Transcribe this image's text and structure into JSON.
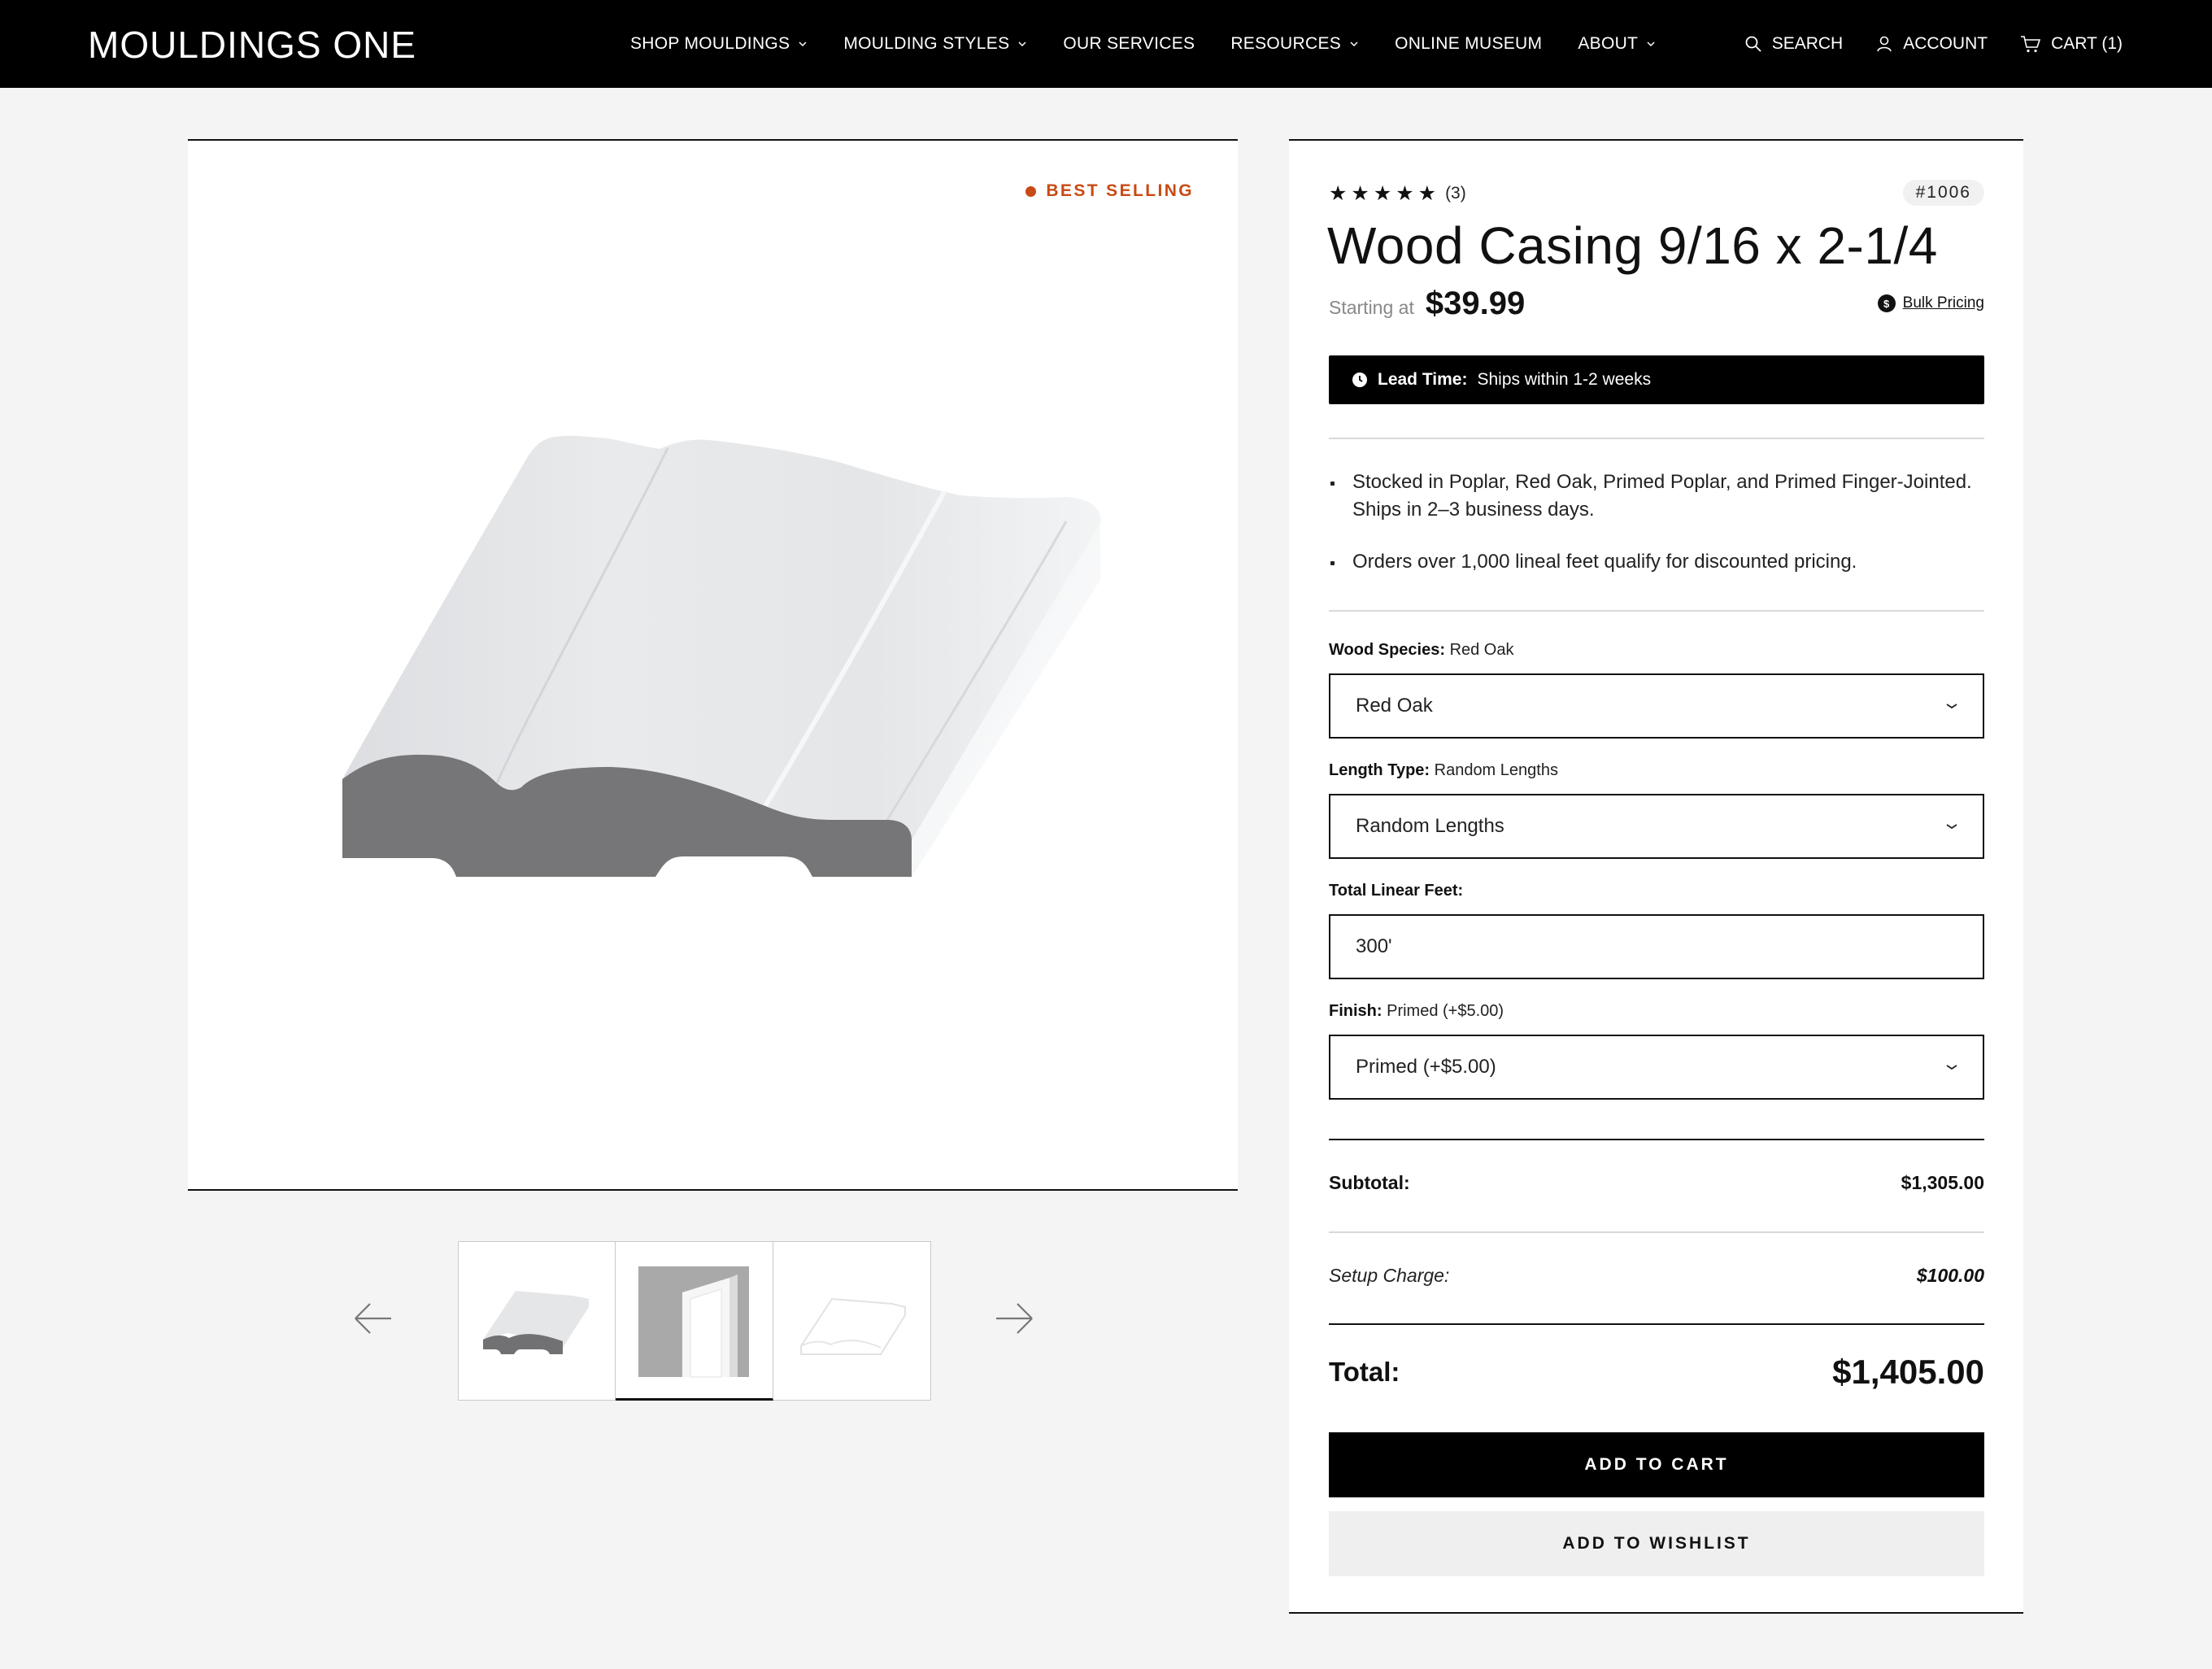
{
  "header": {
    "logo": "MOULDINGS ONE",
    "nav": [
      {
        "label": "SHOP MOULDINGS",
        "has_menu": true
      },
      {
        "label": "MOULDING STYLES",
        "has_menu": true
      },
      {
        "label": "OUR SERVICES",
        "has_menu": false
      },
      {
        "label": "RESOURCES",
        "has_menu": true
      },
      {
        "label": "ONLINE MUSEUM",
        "has_menu": false
      },
      {
        "label": "ABOUT",
        "has_menu": true
      }
    ],
    "search_label": "SEARCH",
    "account_label": "ACCOUNT",
    "cart_label": "CART (1)"
  },
  "gallery": {
    "badge": "BEST SELLING",
    "thumbnails": [
      {
        "name": "thumb-profile",
        "icon": "moulding-profile"
      },
      {
        "name": "thumb-installed",
        "icon": "door-casing-photo"
      },
      {
        "name": "thumb-outline",
        "icon": "moulding-outline"
      }
    ],
    "active_thumbnail": 2
  },
  "product": {
    "stars": "★★★★★",
    "rating_count": "(3)",
    "rating": 5,
    "sku": "#1006",
    "title": "Wood Casing 9/16 x 2-1/4",
    "starting_label": "Starting at",
    "price": "$39.99",
    "bulk_pricing_label": "Bulk Pricing",
    "bulk_icon_glyph": "$",
    "lead_time_label": "Lead Time:",
    "lead_time_value": "Ships within 1-2 weeks",
    "bullets": [
      "Stocked in Poplar, Red Oak, Primed Poplar, and Primed Finger-Jointed. Ships in 2–3 business days.",
      "Orders over 1,000 lineal feet qualify for discounted pricing."
    ]
  },
  "options": {
    "species_label": "Wood Species:",
    "species_value": "Red Oak",
    "species_selected": "Red Oak",
    "length_label": "Length Type:",
    "length_value": "Random Lengths",
    "length_selected": "Random Lengths",
    "feet_label": "Total Linear Feet:",
    "feet_value": "300'",
    "finish_label": "Finish:",
    "finish_value": "Primed (+$5.00)",
    "finish_selected": "Primed (+$5.00)"
  },
  "summary": {
    "subtotal_label": "Subtotal:",
    "subtotal_value": "$1,305.00",
    "setup_label": "Setup Charge:",
    "setup_value": "$100.00",
    "total_label": "Total:",
    "total_value": "$1,405.00"
  },
  "actions": {
    "add_to_cart": "ADD TO CART",
    "add_to_wishlist": "ADD TO WISHLIST"
  },
  "colors": {
    "accent": "#c84a14",
    "header_bg": "#000000",
    "page_bg": "#f4f4f4"
  }
}
